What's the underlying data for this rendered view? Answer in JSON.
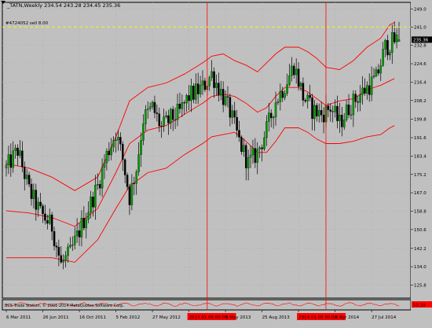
{
  "header": {
    "symbol_line": "_TATN,Weekly  234.54 243.28 234.45 235.36",
    "order_label": "#4724052 sell 8.00"
  },
  "indicator": {
    "label": "BCS Trade Station, © 2001-2014 MetaQuotes Software Corp.",
    "value_label": "55.39"
  },
  "colors": {
    "background": "#c0c0c0",
    "bull": "#00a000",
    "bear": "#000000",
    "wick": "#000000",
    "bands": "#ff0000",
    "marker": "#ff0000",
    "order_line": "#ffff00",
    "price_tag_bg": "#000000",
    "price_tag_text": "#ffffff"
  },
  "chart_data": {
    "type": "candlestick",
    "title": "_TATN,Weekly",
    "ohlc_last": {
      "open": 234.54,
      "high": 243.28,
      "low": 234.45,
      "close": 235.36
    },
    "y_ticks": [
      249.0,
      241.0,
      232.8,
      224.6,
      216.4,
      208.2,
      199.8,
      191.6,
      183.4,
      175.2,
      167.0,
      158.8,
      150.6,
      142.2,
      134.0,
      125.8
    ],
    "ylim": [
      120.0,
      252.0
    ],
    "current_price_label": "235.36",
    "order_line_price": 241.0,
    "x_tick_labels": [
      "6 Mar 2011",
      "26 Jun 2011",
      "16 Oct 2011",
      "5 Feb 2012",
      "27 May 2012",
      "2013.01.06 00:00",
      "5 May 2013",
      "25 Aug 2013",
      "2014.01.05 00:00",
      "6 Apr 2014",
      "27 Jul 2014"
    ],
    "x_tick_positions": [
      0,
      16,
      32,
      48,
      64,
      80,
      96,
      112,
      128,
      144,
      160
    ],
    "highlighted_x_labels": [
      "2013.01.06 00:00",
      "2014.01.05 00:00"
    ],
    "vertical_markers": [
      88,
      140
    ],
    "x_range": [
      0,
      172
    ],
    "upper_band_anchors": [
      [
        0,
        180
      ],
      [
        10,
        178
      ],
      [
        20,
        174
      ],
      [
        30,
        168
      ],
      [
        40,
        174
      ],
      [
        48,
        192
      ],
      [
        54,
        208
      ],
      [
        62,
        214
      ],
      [
        70,
        216
      ],
      [
        78,
        220
      ],
      [
        86,
        225
      ],
      [
        90,
        228
      ],
      [
        95,
        229
      ],
      [
        100,
        226
      ],
      [
        105,
        224
      ],
      [
        110,
        221
      ],
      [
        114,
        225
      ],
      [
        118,
        229
      ],
      [
        122,
        232
      ],
      [
        128,
        232
      ],
      [
        132,
        230
      ],
      [
        136,
        227
      ],
      [
        140,
        223
      ],
      [
        146,
        222
      ],
      [
        152,
        226
      ],
      [
        158,
        232
      ],
      [
        164,
        236
      ],
      [
        168,
        242
      ],
      [
        170,
        243
      ]
    ],
    "middle_band_anchors": [
      [
        0,
        159
      ],
      [
        10,
        158
      ],
      [
        20,
        156
      ],
      [
        30,
        152
      ],
      [
        40,
        160
      ],
      [
        48,
        176
      ],
      [
        54,
        189
      ],
      [
        62,
        195
      ],
      [
        70,
        197
      ],
      [
        78,
        202
      ],
      [
        86,
        207
      ],
      [
        90,
        210
      ],
      [
        95,
        211
      ],
      [
        100,
        210
      ],
      [
        105,
        207
      ],
      [
        110,
        203
      ],
      [
        114,
        205
      ],
      [
        118,
        210
      ],
      [
        122,
        214
      ],
      [
        128,
        214
      ],
      [
        132,
        212
      ],
      [
        136,
        209
      ],
      [
        140,
        206
      ],
      [
        146,
        208
      ],
      [
        152,
        209
      ],
      [
        158,
        213
      ],
      [
        164,
        215
      ],
      [
        168,
        217
      ],
      [
        170,
        218
      ]
    ],
    "lower_band_anchors": [
      [
        0,
        138
      ],
      [
        10,
        138
      ],
      [
        20,
        138
      ],
      [
        30,
        136
      ],
      [
        40,
        146
      ],
      [
        48,
        160
      ],
      [
        54,
        170
      ],
      [
        62,
        176
      ],
      [
        70,
        178
      ],
      [
        78,
        184
      ],
      [
        86,
        189
      ],
      [
        90,
        192
      ],
      [
        95,
        193
      ],
      [
        100,
        194
      ],
      [
        105,
        190
      ],
      [
        110,
        185
      ],
      [
        114,
        185
      ],
      [
        118,
        190
      ],
      [
        122,
        196
      ],
      [
        128,
        196
      ],
      [
        132,
        194
      ],
      [
        136,
        191
      ],
      [
        140,
        189
      ],
      [
        146,
        189
      ],
      [
        152,
        190
      ],
      [
        158,
        192
      ],
      [
        164,
        193
      ],
      [
        168,
        196
      ],
      [
        170,
        197
      ]
    ],
    "price_path_anchors": [
      [
        0,
        178
      ],
      [
        5,
        186
      ],
      [
        10,
        168
      ],
      [
        15,
        158
      ],
      [
        20,
        152
      ],
      [
        24,
        135
      ],
      [
        28,
        140
      ],
      [
        32,
        150
      ],
      [
        36,
        160
      ],
      [
        40,
        170
      ],
      [
        44,
        184
      ],
      [
        48,
        194
      ],
      [
        51,
        182
      ],
      [
        54,
        165
      ],
      [
        57,
        178
      ],
      [
        60,
        200
      ],
      [
        64,
        205
      ],
      [
        68,
        196
      ],
      [
        72,
        200
      ],
      [
        76,
        203
      ],
      [
        80,
        210
      ],
      [
        86,
        214
      ],
      [
        90,
        220
      ],
      [
        94,
        212
      ],
      [
        98,
        203
      ],
      [
        102,
        190
      ],
      [
        106,
        180
      ],
      [
        110,
        185
      ],
      [
        114,
        195
      ],
      [
        118,
        208
      ],
      [
        122,
        215
      ],
      [
        126,
        224
      ],
      [
        130,
        210
      ],
      [
        134,
        204
      ],
      [
        138,
        202
      ],
      [
        142,
        205
      ],
      [
        146,
        198
      ],
      [
        150,
        205
      ],
      [
        154,
        210
      ],
      [
        158,
        214
      ],
      [
        162,
        218
      ],
      [
        166,
        232
      ],
      [
        170,
        235
      ]
    ]
  }
}
